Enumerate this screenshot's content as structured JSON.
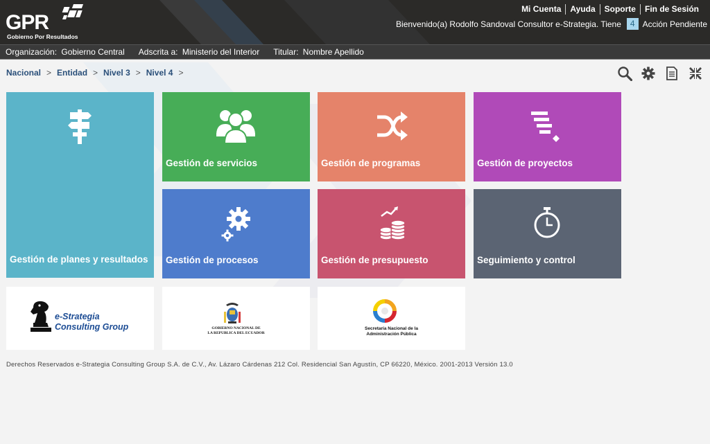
{
  "header": {
    "logo_text": "GPR",
    "logo_subtitle": "Gobierno Por Resultados",
    "links": [
      "Mi Cuenta",
      "Ayuda",
      "Soporte",
      "Fin de Sesión"
    ],
    "welcome_text": "Bienvenido(a) Rodolfo Sandoval Consultor e-Strategia. Tiene",
    "pending_count": "4",
    "pending_text": "Acción Pendiente"
  },
  "orgbar": {
    "org_label": "Organización:",
    "org_value": "Gobierno Central",
    "adscrita_label": "Adscrita a:",
    "adscrita_value": "Ministerio del Interior",
    "titular_label": "Titular:",
    "titular_value": "Nombre Apellido"
  },
  "breadcrumb": [
    "Nacional",
    "Entidad",
    "Nivel 3",
    "Nivel 4"
  ],
  "toolbar_icons": [
    "search-icon",
    "gear-icon",
    "document-icon",
    "collapse-icon"
  ],
  "tiles": {
    "planes": {
      "label": "Gestión de planes y resultados",
      "color": "#5bb4c9",
      "icon": "signpost-icon"
    },
    "servicios": {
      "label": "Gestión de servicios",
      "color": "#47ad57",
      "icon": "users-icon"
    },
    "programas": {
      "label": "Gestión de programas",
      "color": "#e5836a",
      "icon": "shuffle-icon"
    },
    "proyectos": {
      "label": "Gestión de proyectos",
      "color": "#b04ab8",
      "icon": "gantt-icon"
    },
    "procesos": {
      "label": "Gestión de procesos",
      "color": "#4e7ccc",
      "icon": "gears-icon"
    },
    "presupuesto": {
      "label": "Gestión de presupuesto",
      "color": "#c8546f",
      "icon": "coins-icon"
    },
    "seguimiento": {
      "label": "Seguimiento y control",
      "color": "#5b6473",
      "icon": "stopwatch-icon"
    }
  },
  "partners": {
    "estrategia_line1": "e-Strategia",
    "estrategia_line2": "Consulting Group",
    "gobierno_line1": "GOBIERNO NACIONAL DE",
    "gobierno_line2": "LA REPUBLICA DEL ECUADOR",
    "secretaria_line1": "Secretaría Nacional de la",
    "secretaria_line2": "Administración Pública"
  },
  "footer": "Derechos Reservados e-Strategia Consulting Group S.A. de C.V., Av. Lázaro Cárdenas 212 Col. Residencial San Agustín, CP 66220, México. 2001-2013 Versión 13.0"
}
